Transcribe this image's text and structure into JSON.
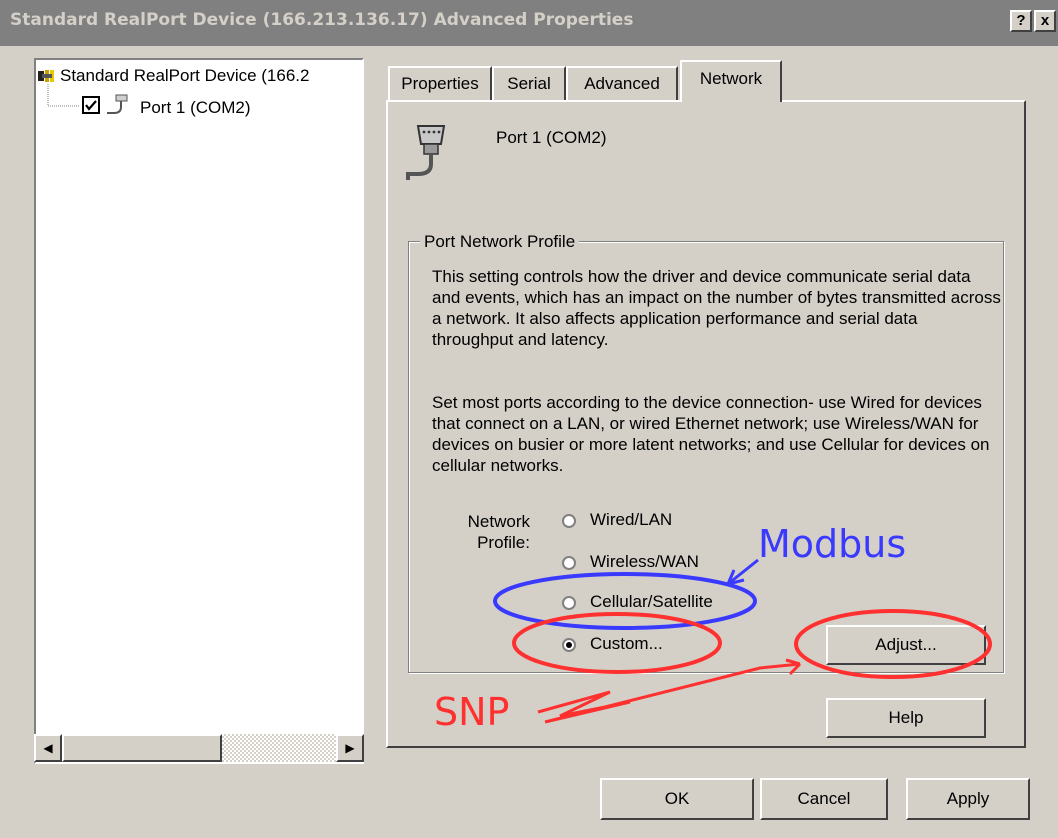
{
  "window": {
    "title": "Standard RealPort Device (166.213.136.17) Advanced Properties",
    "help_button": "?",
    "close_button": "x"
  },
  "tree": {
    "root_label": "Standard RealPort Device (166.2",
    "child_label": "Port 1 (COM2)",
    "child_checked": true
  },
  "tabs": [
    {
      "label": "Properties",
      "active": false
    },
    {
      "label": "Serial",
      "active": false
    },
    {
      "label": "Advanced",
      "active": false
    },
    {
      "label": "Network",
      "active": true
    }
  ],
  "port": {
    "name": "Port 1 (COM2)",
    "icon": "serial-port-icon"
  },
  "group": {
    "title": "Port Network Profile",
    "description_1": "This setting controls how the driver and device communicate serial data and events, which has an impact on the number of bytes transmitted across a network.  It also affects application performance and serial data throughput and latency.",
    "description_2": "Set most ports according to the device connection- use Wired for devices that connect on a LAN, or wired Ethernet network; use Wireless/WAN for devices on busier or more latent networks; and use Cellular for devices on cellular networks.",
    "profile_label_line1": "Network",
    "profile_label_line2": "Profile:",
    "options": [
      {
        "label": "Wired/LAN",
        "selected": false
      },
      {
        "label": "Wireless/WAN",
        "selected": false
      },
      {
        "label": "Cellular/Satellite",
        "selected": false
      },
      {
        "label": "Custom...",
        "selected": true
      }
    ],
    "adjust_button": "Adjust..."
  },
  "buttons": {
    "help": "Help",
    "ok": "OK",
    "cancel": "Cancel",
    "apply": "Apply"
  },
  "annotations": {
    "modbus": "Modbus",
    "snp": "SNP",
    "modbus_color": "#3a3aff",
    "snp_color": "#ff3030"
  }
}
